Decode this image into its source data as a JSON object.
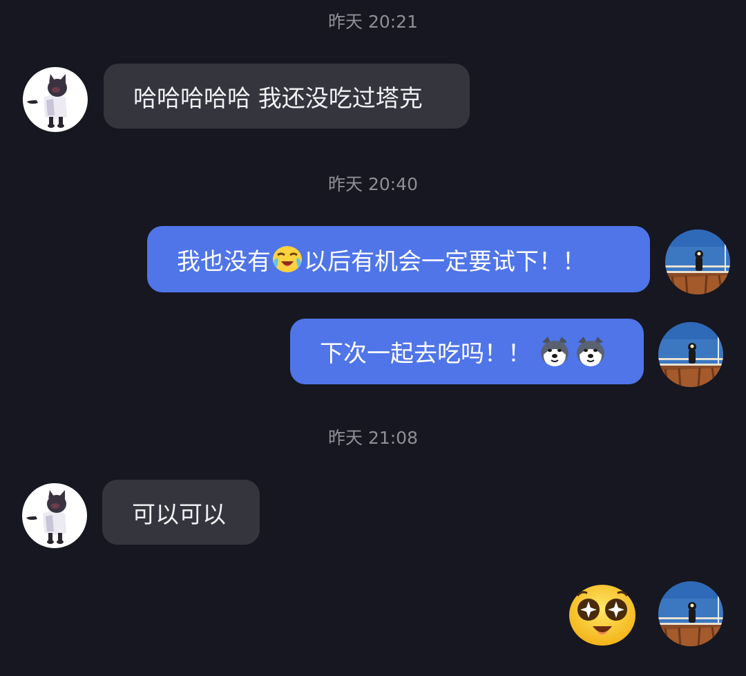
{
  "messages": [
    {
      "type": "timestamp",
      "text": "昨天 20:21"
    },
    {
      "type": "incoming",
      "text": "哈哈哈哈哈 我还没吃过塔克"
    },
    {
      "type": "timestamp",
      "text": "昨天 20:40"
    },
    {
      "type": "outgoing",
      "text_before": "我也没有",
      "emoji": "crying-laughing-emoji",
      "text_after": " 以后有机会一定要试下！！"
    },
    {
      "type": "outgoing",
      "text": "下次一起去吃吗！！",
      "emoji": [
        "husky-dog-emoji",
        "husky-dog-emoji"
      ]
    },
    {
      "type": "timestamp",
      "text": "昨天 21:08"
    },
    {
      "type": "incoming",
      "text": "可以可以"
    },
    {
      "type": "outgoing-sticker",
      "emoji": "starry-eyes-emoji"
    }
  ],
  "colors": {
    "background": "#161720",
    "incoming_bubble": "#34353d",
    "outgoing_bubble": "#4f75e8",
    "timestamp_text": "#8e9096"
  },
  "avatars": {
    "contact": "cat-avatar",
    "self": "sky-railing-avatar"
  }
}
